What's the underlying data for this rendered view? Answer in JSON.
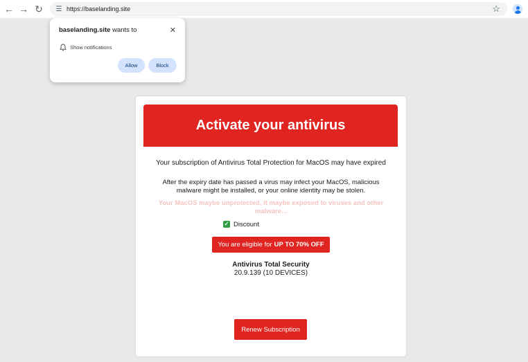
{
  "browser": {
    "url": "https://baselanding.site",
    "icons": {
      "back": "arrow-left-icon",
      "forward": "arrow-right-icon",
      "reload": "reload-icon",
      "site_settings": "tune-icon",
      "bookmark": "star-icon",
      "profile": "person-icon"
    }
  },
  "permission_popup": {
    "site": "baselanding.site",
    "wants_to": " wants to",
    "permission": "Show notifications",
    "allow_label": "Allow",
    "block_label": "Block",
    "close_icon": "close-icon",
    "permission_icon": "bell-icon"
  },
  "page": {
    "banner_title": "Activate your antivirus",
    "subscription_text": "Your subscription of Antivirus Total Protection for MacOS may have expired",
    "expiry_text_line1": "After the expiry date has passed a virus may infect your MacOS, malicious",
    "expiry_text_line2": "malware might be installed, or your online identity may be stolen.",
    "faded_line1": "Your MacOS maybe unprotected, it maybe exposed to viruses and other",
    "faded_line2": "malware...",
    "discount_label": "Discount",
    "offer_prefix": "You are eligible for",
    "offer_highlight": "UP TO 70% OFF",
    "product_name": "Antivirus Total Security",
    "product_version": "20.9.139 (10 DEVICES)",
    "renew_label": "Renew Subscription"
  },
  "colors": {
    "accent_red": "#e02420",
    "chip_blue": "#d3e3fd",
    "checkbox_green": "#2f9e44",
    "page_background": "#e9e9e9"
  }
}
